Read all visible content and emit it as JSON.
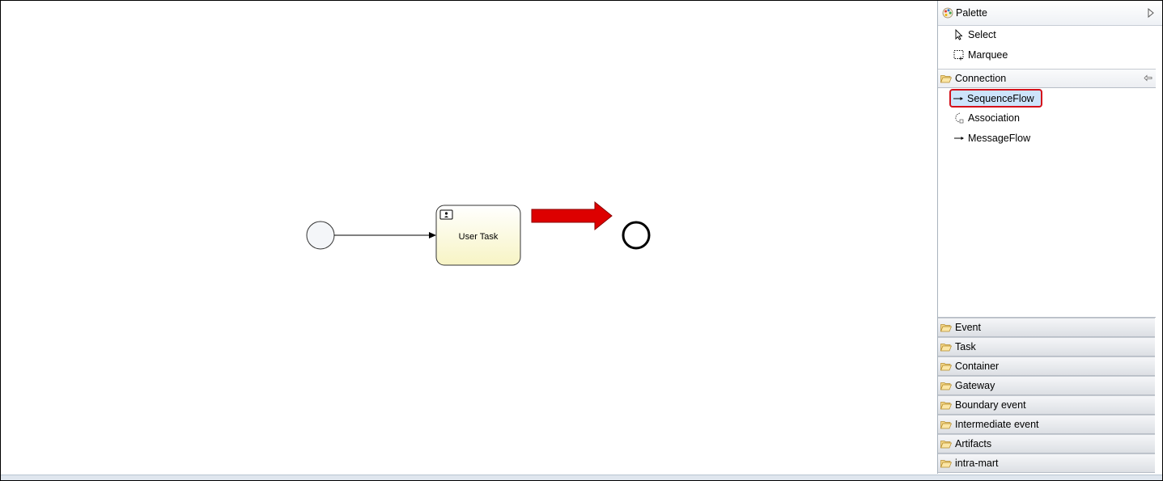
{
  "diagram": {
    "task_label": "User Task"
  },
  "palette": {
    "title": "Palette",
    "tools": [
      {
        "label": "Select",
        "icon": "pointer-icon"
      },
      {
        "label": "Marquee",
        "icon": "marquee-icon"
      }
    ],
    "connection": {
      "label": "Connection",
      "items": [
        {
          "label": "SequenceFlow",
          "icon": "arrow-right-icon",
          "selected": true
        },
        {
          "label": "Association",
          "icon": "association-icon"
        },
        {
          "label": "MessageFlow",
          "icon": "arrow-right-icon"
        }
      ]
    },
    "drawers": [
      "Event",
      "Task",
      "Container",
      "Gateway",
      "Boundary event",
      "Intermediate event",
      "Artifacts",
      "intra-mart"
    ]
  },
  "colors": {
    "highlight_arrow": "#dd0000",
    "selection_border": "#d4101a",
    "selection_fill": "#cde4fb",
    "task_fill": "#fdfbd6"
  }
}
